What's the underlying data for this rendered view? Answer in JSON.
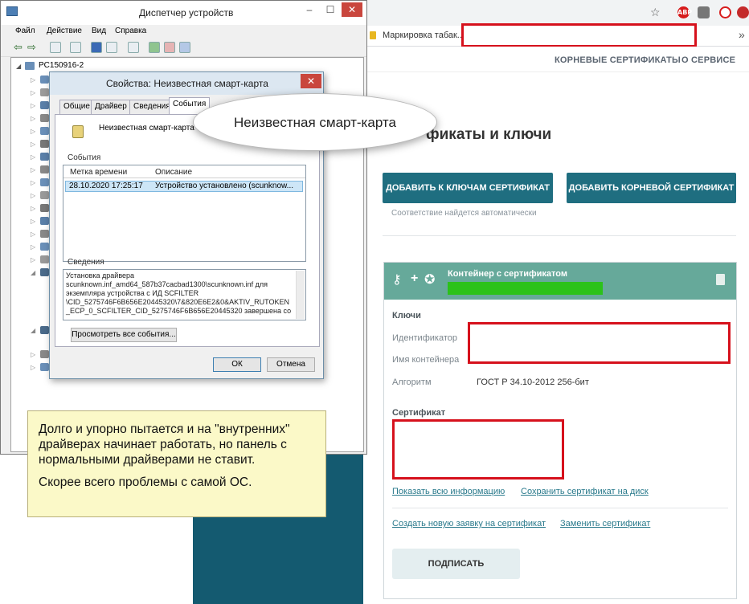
{
  "device_manager": {
    "title": "Диспетчер устройств",
    "menu": [
      "Файл",
      "Действие",
      "Вид",
      "Справка"
    ],
    "computer_name": "PC150916-2"
  },
  "properties_dialog": {
    "title": "Свойства: Неизвестная смарт-карта",
    "tabs": [
      "Общие",
      "Драйвер",
      "Сведения",
      "События"
    ],
    "active_tab": "События",
    "device_name": "Неизвестная смарт-карта",
    "events_label": "События",
    "columns": [
      "Метка времени",
      "Описание"
    ],
    "event_timestamp": "28.10.2020 17:25:17",
    "event_description": "Устройство установлено (scunknow...",
    "details_label": "Сведения",
    "details_lines": [
      "Установка драйвера",
      "scunknown.inf_amd64_587b37cacbad1300\\scunknown.inf для",
      "экземпляра устройства с ИД SCFILTER",
      "\\CID_5275746F6B656E20445320\\7&820E6E2&0&AKTIV_RUTOKEN",
      "_ECP_0_SCFILTER_CID_5275746F6B656E20445320 завершена со"
    ],
    "view_all_button": "Просмотреть все события...",
    "ok_button": "ОК",
    "cancel_button": "Отмена"
  },
  "callout": {
    "text": "Неизвестная смарт-карта"
  },
  "note": {
    "paragraph1": "Долго и упорно пытается и на \"внутренних\" драйверах начинает работать, но панель с нормальными драйверами не ставит.",
    "paragraph2": "Скорее всего проблемы с самой ОС."
  },
  "browser": {
    "bookmark_label": "Маркировка табак...",
    "extension_abp": "ABP",
    "overflow": "»"
  },
  "app": {
    "nav": [
      "КОРНЕВЫЕ СЕРТИФИКАТЫ",
      "О СЕРВИСЕ"
    ],
    "heading_partial": "фикаты и ключи",
    "add_to_keys_button": "ДОБАВИТЬ К КЛЮЧАМ СЕРТИФИКАТ",
    "add_root_button": "ДОБАВИТЬ КОРНЕВОЙ СЕРТИФИКАТ",
    "auto_match_hint": "Соответствие найдется автоматически",
    "container": {
      "title": "Контейнер с сертификатом",
      "keys_label": "Ключи",
      "identifier_label": "Идентификатор",
      "container_name_label": "Имя контейнера",
      "algorithm_label": "Алгоритм",
      "algorithm_value": "ГОСТ Р 34.10-2012 256-бит",
      "certificate_label": "Сертификат",
      "show_all_link": "Показать всю информацию",
      "save_cert_link": "Сохранить сертификат на диск",
      "new_request_link": "Создать новую заявку на сертификат",
      "replace_cert_link": "Заменить сертификат",
      "sign_button": "ПОДПИСАТЬ"
    }
  },
  "colors": {
    "teal_button": "#1f6e80",
    "teal_block": "#145a70",
    "card_header": "#66a99a",
    "redaction_border": "#d6111c",
    "redaction_green": "#2bc21a",
    "note_background": "#fbf9c8"
  }
}
